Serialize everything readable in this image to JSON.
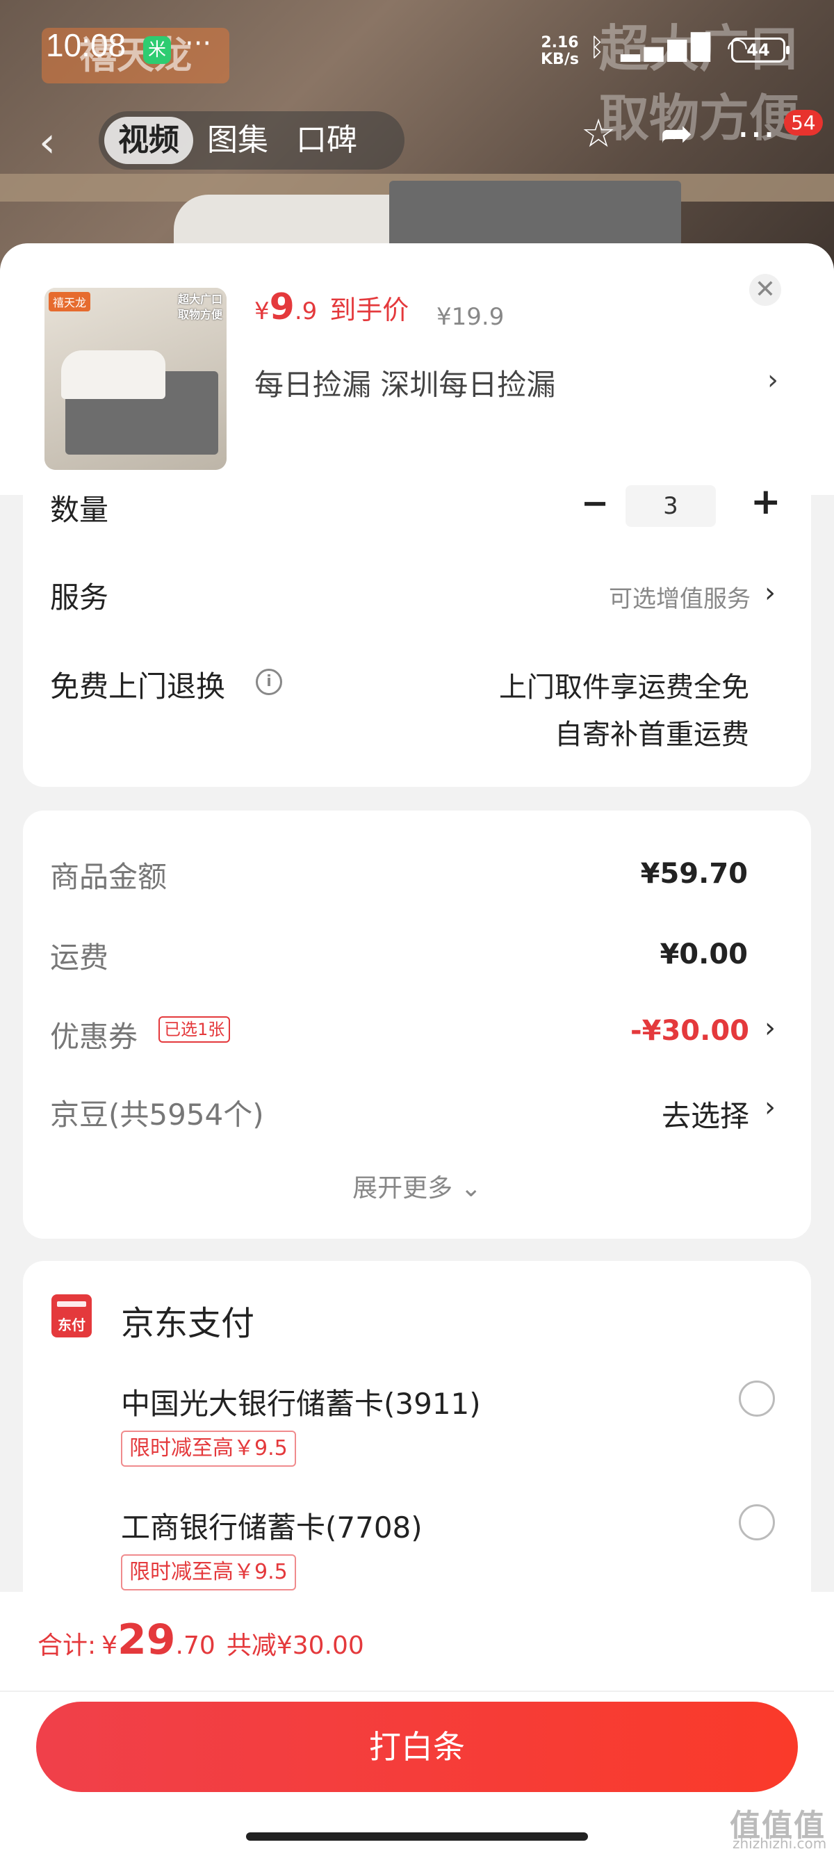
{
  "status_bar": {
    "time": "10:08",
    "app_badge": "米",
    "dots": "···",
    "speed_top": "2.16",
    "speed_bottom": "KB/s",
    "battery": "44"
  },
  "hero": {
    "brand_watermark": "禧天龙",
    "watermark_line1": "超大广口",
    "watermark_line2": "取物方便"
  },
  "nav": {
    "tabs": [
      "视频",
      "图集",
      "口碑"
    ],
    "active_tab": "视频",
    "badge": "54"
  },
  "product": {
    "image_logo": "禧天龙",
    "image_text_line1": "超大广口",
    "image_text_line2": "取物方便",
    "currency": "¥",
    "price_int": "9",
    "price_dec": ".9",
    "price_label": "到手价",
    "original_price": "¥19.9",
    "shop_line": "每日捡漏  深圳每日捡漏"
  },
  "options": {
    "qty_label": "数量",
    "qty_value": "3",
    "service_label": "服务",
    "service_value": "可选增值服务",
    "return_label": "免费上门退换",
    "return_value_line1": "上门取件享运费全免",
    "return_value_line2": "自寄补首重运费"
  },
  "amounts": {
    "goods_label": "商品金额",
    "goods_value": "¥59.70",
    "shipping_label": "运费",
    "shipping_value": "¥0.00",
    "coupon_label": "优惠券",
    "coupon_tag": "已选1张",
    "coupon_value": "-¥30.00",
    "jingdou_label": "京豆(共5954个)",
    "jingdou_value": "去选择",
    "expand_label": "展开更多"
  },
  "payment": {
    "title": "京东支付",
    "icon_text": "东付",
    "banks": [
      {
        "name": "中国光大银行储蓄卡(3911)",
        "promo": "限时减至高￥9.5"
      },
      {
        "name": "工商银行储蓄卡(7708)",
        "promo": "限时减至高￥9.5"
      }
    ]
  },
  "footer": {
    "total_label": "合计:",
    "total_currency": "¥",
    "total_int": "29",
    "total_dec": ".70",
    "total_save": "共减¥30.00",
    "button_label": "打白条"
  },
  "watermark": {
    "text": "值值值",
    "url": "zhizhizhi.com"
  },
  "colors": {
    "accent_red": "#e4393c",
    "button_gradient_start": "#f0404a",
    "button_gradient_end": "#fa3a2a"
  }
}
